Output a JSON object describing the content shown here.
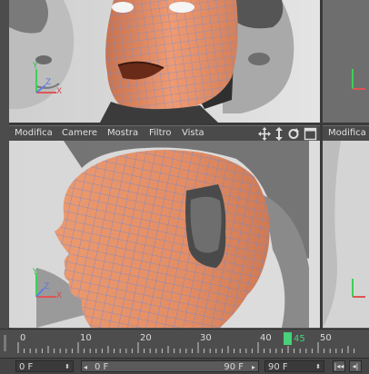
{
  "colors": {
    "accent": "#46d17a",
    "mesh_skin": "#e8916a",
    "wireframe": "#6f8ed6",
    "panel_bg": "#4a4a4a"
  },
  "viewport_left_bottom": {
    "menu": [
      "Modifica",
      "Camere",
      "Mostra",
      "Filtro",
      "Vista"
    ],
    "icons": [
      "move-icon",
      "arrows-updown-icon",
      "rotate-icon",
      "maximize-icon"
    ]
  },
  "viewport_right_bottom": {
    "menu": [
      "Modifica"
    ]
  },
  "axis_labels": {
    "x": "X",
    "y": "Y",
    "z": "Z"
  },
  "timeline": {
    "tick_labels": [
      "0",
      "10",
      "20",
      "30",
      "40",
      "50"
    ],
    "current_frame": "45",
    "current_frame_fraction": 0.9
  },
  "bottombar": {
    "start_field": "0 F",
    "range_start": "0 F",
    "range_end": "90 F",
    "end_field": "90 F",
    "buttons": [
      "first-frame-icon",
      "previous-frame-icon"
    ]
  }
}
